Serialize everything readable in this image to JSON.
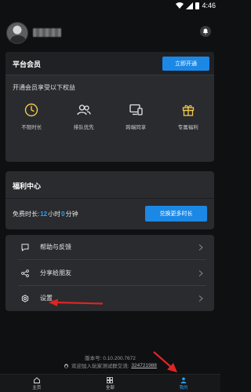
{
  "status_bar": {
    "time": "4:46"
  },
  "header": {
    "bell_icon": "bell-icon"
  },
  "vip": {
    "title": "平台会员",
    "open_button": "立即开通",
    "subtitle": "开通会员享受以下权益",
    "perks": [
      {
        "label": "不限时长",
        "icon": "clock-icon"
      },
      {
        "label": "排队优先",
        "icon": "users-icon"
      },
      {
        "label": "跨端同享",
        "icon": "devices-icon"
      },
      {
        "label": "专属福利",
        "icon": "gift-icon"
      }
    ]
  },
  "welfare": {
    "title": "福利中心",
    "free_time_label": "免费时长:",
    "hours": "12",
    "hours_unit": "小时",
    "minutes": "0",
    "minutes_unit": "分钟",
    "exchange_button": "兑换更多时长"
  },
  "menu": {
    "items": [
      {
        "label": "帮助与反馈",
        "icon": "chat-icon"
      },
      {
        "label": "分享给朋友",
        "icon": "share-icon"
      },
      {
        "label": "设置",
        "icon": "settings-icon"
      }
    ]
  },
  "footer": {
    "version": "版本号: 0.10.200.7672",
    "join_text": "欢迎加入玩家测试群交流:",
    "qq_group": "324721988"
  },
  "bottom_nav": {
    "items": [
      {
        "label": "主页",
        "icon": "home-icon"
      },
      {
        "label": "全部",
        "icon": "grid-icon"
      },
      {
        "label": "我的",
        "icon": "person-icon"
      }
    ],
    "active_index": 2
  },
  "colors": {
    "accent": "#1c88e6",
    "highlight": "#2aa3ff",
    "annotation_arrow": "#e02424"
  }
}
